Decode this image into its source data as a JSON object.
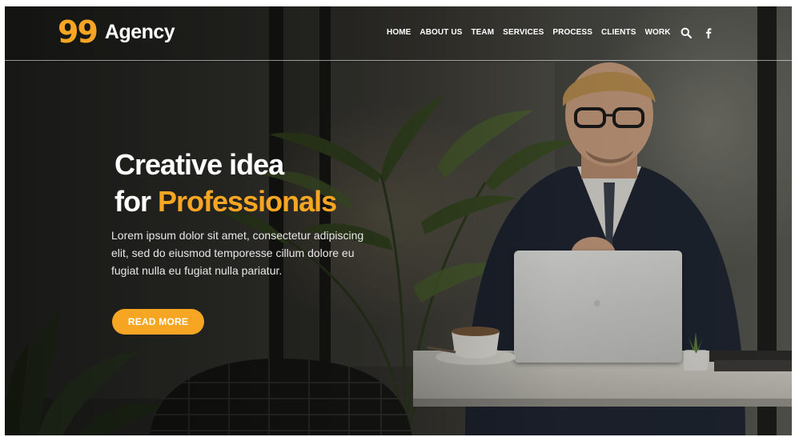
{
  "brand": {
    "mark": "99",
    "name": "Agency",
    "accent_color": "#f6a623"
  },
  "nav": {
    "items": [
      "HOME",
      "ABOUT US",
      "TEAM",
      "SERVICES",
      "PROCESS",
      "CLIENTS",
      "WORK"
    ],
    "icons": [
      "search-icon",
      "facebook-icon"
    ]
  },
  "hero": {
    "title_line1": "Creative idea",
    "title_line2_prefix": "for",
    "title_line2_accent": "Professionals",
    "description_lines": [
      "Lorem ipsum dolor sit amet, consectetur adipiscing",
      "elit, sed do eiusmod temporesse cillum dolore eu",
      "fugiat nulla eu fugiat nulla pariatur."
    ],
    "cta_label": "READ MORE"
  },
  "colors": {
    "accent": "#f6a623",
    "text": "#ffffff"
  }
}
